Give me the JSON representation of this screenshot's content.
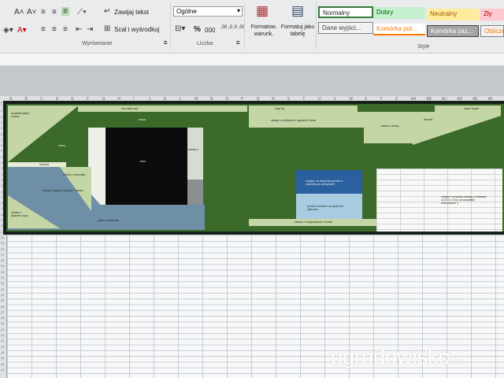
{
  "ribbon": {
    "wrap_text": "Zawijaj tekst",
    "merge_center": "Scal i wyśrodkuj",
    "number_format": "Ogólne",
    "percent": "%",
    "thousands": "000",
    "dec_increase": ",00 ,0",
    "dec_decrease": ",0 ,00",
    "cond_format": "Formatow. warunk.",
    "format_table": "Formatuj jako tabelę",
    "groups": {
      "alignment": "Wyrównanie",
      "number": "Liczba",
      "styles": "Style"
    },
    "styles": [
      {
        "label": "Normalny",
        "bg": "#ffffff",
        "fg": "#222222"
      },
      {
        "label": "Dobry",
        "bg": "#c6efce",
        "fg": "#006100"
      },
      {
        "label": "Neutralny",
        "bg": "#ffeb9c",
        "fg": "#9c5700"
      },
      {
        "label": "Zły",
        "bg": "#ffc7ce",
        "fg": "#9c0006"
      },
      {
        "label": "Dane wyjści...",
        "bg": "#f2f2f2",
        "fg": "#3f3f3f"
      },
      {
        "label": "Komórka poł...",
        "bg": "#ffffff",
        "fg": "#fa7d00"
      },
      {
        "label": "Komórka zaz...",
        "bg": "#a5a5a5",
        "fg": "#ffffff"
      },
      {
        "label": "Obliczen",
        "bg": "#f2f2f2",
        "fg": "#fa7d00"
      }
    ]
  },
  "columns": [
    "A",
    "B",
    "C",
    "D",
    "E",
    "F",
    "G",
    "H",
    "I",
    "J",
    "K",
    "L",
    "M",
    "N",
    "O",
    "P",
    "Q",
    "R",
    "S",
    "T",
    "U",
    "V",
    "W",
    "X",
    "Y",
    "Z",
    "AA",
    "AB",
    "AC",
    "AD",
    "AE",
    "AF"
  ],
  "rows": [
    "1",
    "2",
    "3",
    "4",
    "5",
    "6",
    "7",
    "8",
    "9",
    "10",
    "11",
    "12",
    "13",
    "14",
    "15",
    "16",
    "17",
    "18",
    "19",
    "20",
    "21",
    "22",
    "23",
    "24",
    "25",
    "26",
    "27",
    "28",
    "29",
    "30",
    "31",
    "32",
    "33",
    "34",
    "35",
    "36",
    "37",
    "38",
    "39",
    "40",
    "41",
    "42",
    "43",
    "44",
    "45",
    "46",
    "47"
  ],
  "plan": {
    "labels": {
      "top_hedge": "buk       cały mąd",
      "top_right": "mąd bij",
      "far_right": "mąd i kopec",
      "tulips": "tulipan",
      "lawn": "trawa",
      "house": "dom",
      "left_corner": "szafirki/kwiaty i rośliny",
      "strip": "tawa",
      "path": "ścieżka",
      "terrace": "miejsce wyjścia / zjazdu z tarasu",
      "veg_left": "rośliny i ziemniaki",
      "bed_left": "rabata z lipskami iryzy",
      "drive_bottom": "zjazd z kamienia",
      "right_strip1": "trawa z resztą",
      "right_strip2": "rabata z",
      "right_strip3": "trawnik",
      "middle_bed": "rabata z roślinami w ogrodzie i kilak",
      "flower_bed": "miejsce na kwiaty i rośliny do ogrodu",
      "blue_top": "miejsce na długi warzywnik w oddzielnych skrzyniach",
      "blue_bottom": "perski w oknach na razie jest wybrane",
      "bottom_bed": "rabata z margerytkami i krzaki",
      "note": "miejsce na ławkę rabatkę z kwiatami 12,5 m x 10m na wszystkie stosunkowe 1"
    }
  },
  "watermark": {
    "main": "ogrodowisko",
    "suffix": ".pl"
  }
}
